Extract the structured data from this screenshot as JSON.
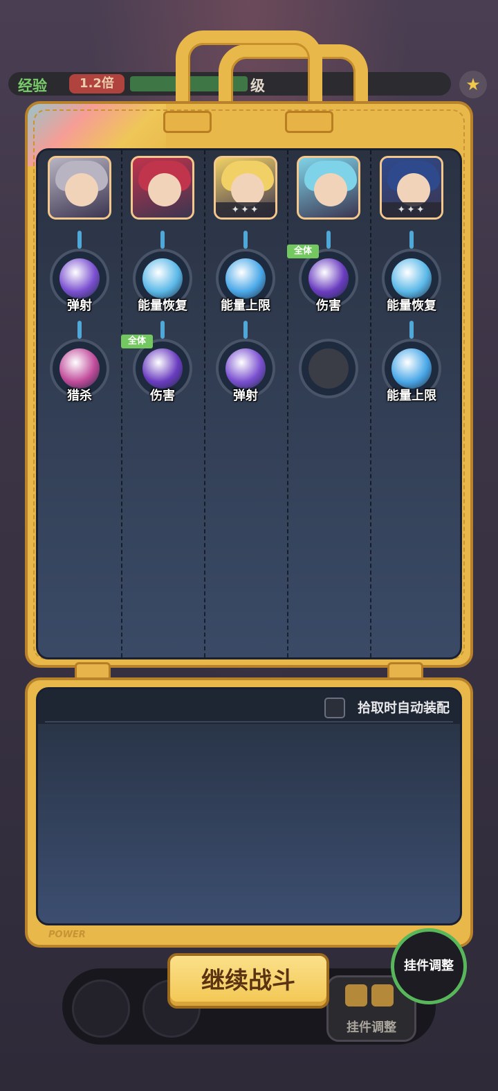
{
  "hud": {
    "exp_label": "经验",
    "exp_multiplier": "1.2倍",
    "level_label": "级",
    "exp_progress": 0.45
  },
  "heroes": [
    {
      "stars": "",
      "hair": "#b8b4c2",
      "frame": "#f4c78c"
    },
    {
      "stars": "",
      "hair": "#c0344c",
      "frame": "#f4c78c"
    },
    {
      "stars": "✦✦✦",
      "hair": "#f1d066",
      "frame": "#f4c78c"
    },
    {
      "stars": "",
      "hair": "#7fd3e8",
      "frame": "#f4c78c"
    },
    {
      "stars": "✦✦✦",
      "hair": "#2f4a8c",
      "frame": "#f4c78c"
    }
  ],
  "charms_row1": [
    {
      "label": "弹射",
      "icon": "lightning-cat-icon",
      "color": "#7a4fd0",
      "tag": ""
    },
    {
      "label": "能量恢复",
      "icon": "energy-can-icon",
      "color": "#5ab8e8",
      "tag": ""
    },
    {
      "label": "能量上限",
      "icon": "water-drop-icon",
      "color": "#4aa8e8",
      "tag": ""
    },
    {
      "label": "伤害",
      "icon": "muscle-cat-icon",
      "color": "#6a3cc0",
      "tag": "全体"
    },
    {
      "label": "能量恢复",
      "icon": "energy-can-icon",
      "color": "#5ab8e8",
      "tag": ""
    }
  ],
  "charms_row2": [
    {
      "label": "猎杀",
      "icon": "claw-icon",
      "color": "#c04a9a",
      "tag": ""
    },
    {
      "label": "伤害",
      "icon": "muscle-cat-icon",
      "color": "#6a3cc0",
      "tag": "全体"
    },
    {
      "label": "弹射",
      "icon": "lightning-cat-icon",
      "color": "#7a4fd0",
      "tag": ""
    },
    {
      "label": "",
      "icon": "empty-star-slot-icon",
      "color": "#3a3d46",
      "tag": ""
    },
    {
      "label": "能量上限",
      "icon": "water-drop-icon",
      "color": "#4aa8e8",
      "tag": ""
    }
  ],
  "lower": {
    "auto_equip_label": "拾取时自动装配",
    "power_text": "POWER"
  },
  "buttons": {
    "continue": "继续战斗",
    "adjust": "挂件调整",
    "adjust_round": "挂件调整"
  }
}
